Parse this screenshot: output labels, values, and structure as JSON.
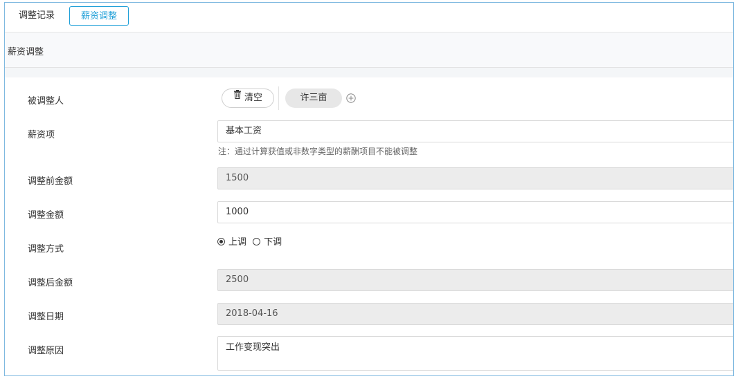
{
  "tabs": [
    {
      "label": "调整记录",
      "active": false
    },
    {
      "label": "薪资调整",
      "active": true
    }
  ],
  "section": {
    "title": "薪资调整"
  },
  "form": {
    "adjustee": {
      "label": "被调整人",
      "clear_label": "清空",
      "selected_person": "许三亩"
    },
    "salary_item": {
      "label": "薪资项",
      "value": "基本工资",
      "note": "注：通过计算获值或非数字类型的薪酬项目不能被调整"
    },
    "amount_before": {
      "label": "调整前金额",
      "value": "1500"
    },
    "adjust_amount": {
      "label": "调整金额",
      "value": "1000"
    },
    "adjust_method": {
      "label": "调整方式",
      "options": [
        {
          "label": "上调",
          "checked": true
        },
        {
          "label": "下调",
          "checked": false
        }
      ]
    },
    "amount_after": {
      "label": "调整后金额",
      "value": "2500"
    },
    "adjust_date": {
      "label": "调整日期",
      "value": "2018-04-16"
    },
    "adjust_reason": {
      "label": "调整原因",
      "value": "工作变现突出"
    }
  },
  "colors": {
    "accent": "#1e9fd8",
    "frame_border": "#7fb9e0",
    "disabled_bg": "#ececec"
  }
}
